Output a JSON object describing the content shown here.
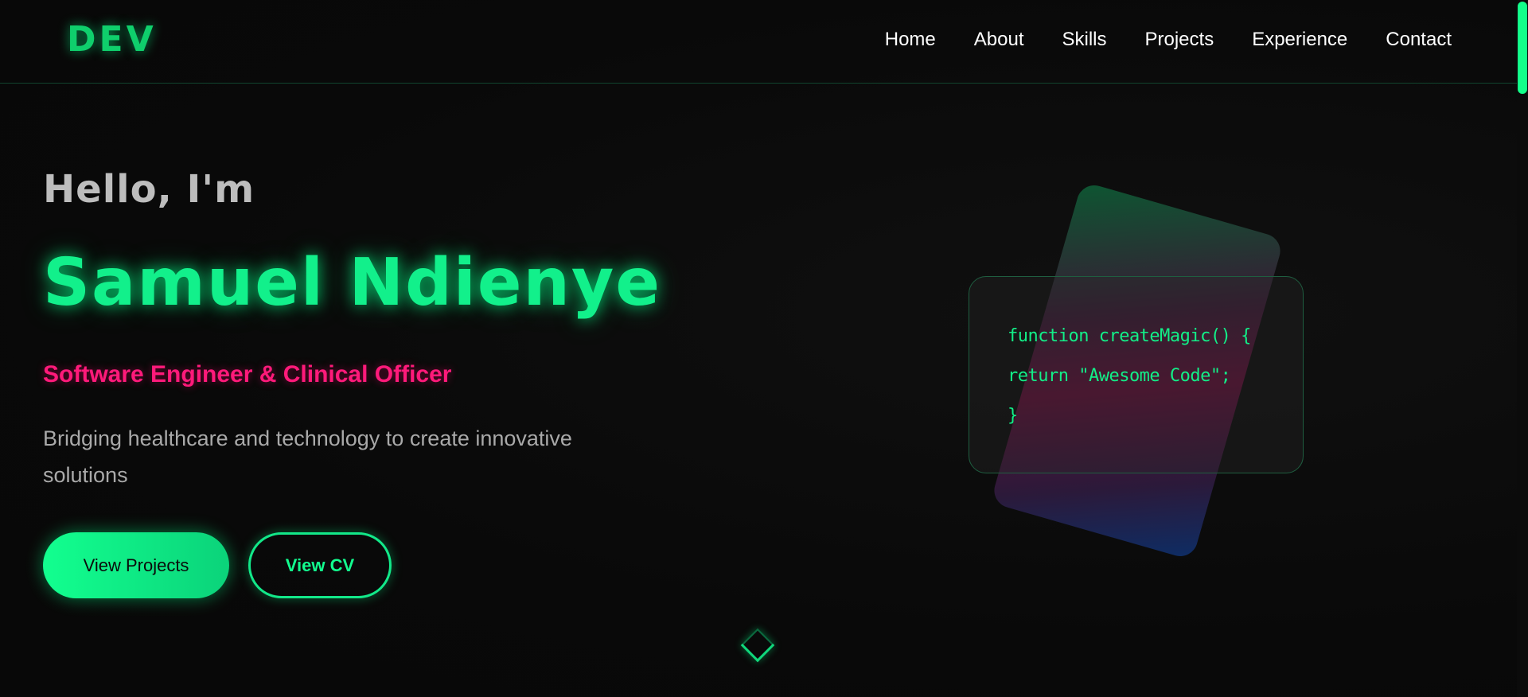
{
  "header": {
    "logo": "DEV",
    "nav": [
      {
        "label": "Home"
      },
      {
        "label": "About"
      },
      {
        "label": "Skills"
      },
      {
        "label": "Projects"
      },
      {
        "label": "Experience"
      },
      {
        "label": "Contact"
      }
    ]
  },
  "hero": {
    "greeting": "Hello, I'm",
    "name": "Samuel Ndienye",
    "role": "Software Engineer & Clinical Officer",
    "description": "Bridging healthcare and technology to create innovative solutions",
    "primary_button": "View Projects",
    "secondary_button": "View CV"
  },
  "code_card": {
    "lines": [
      "function createMagic() {",
      "return \"Awesome Code\";",
      "}"
    ]
  },
  "icons": {
    "scroll_down": "chevron-down-icon"
  },
  "colors": {
    "accent": "#12ff8f",
    "pink": "#ff1a7a",
    "background": "#0a0a0a"
  }
}
